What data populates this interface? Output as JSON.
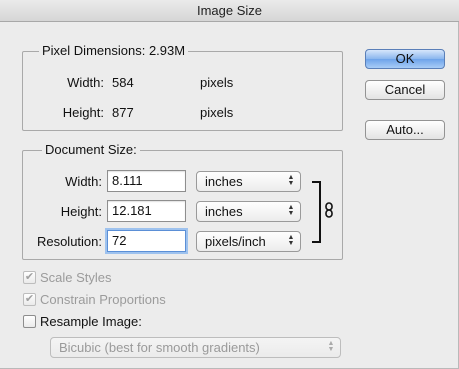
{
  "window": {
    "title": "Image Size"
  },
  "pixel_dimensions": {
    "legend": "Pixel Dimensions:",
    "size": "2.93M",
    "width_label": "Width:",
    "width_value": "584",
    "width_unit": "pixels",
    "height_label": "Height:",
    "height_value": "877",
    "height_unit": "pixels"
  },
  "document_size": {
    "legend": "Document Size:",
    "width_label": "Width:",
    "width_value": "8.111",
    "width_unit": "inches",
    "height_label": "Height:",
    "height_value": "12.181",
    "height_unit": "inches",
    "resolution_label": "Resolution:",
    "resolution_value": "72",
    "resolution_unit": "pixels/inch"
  },
  "options": {
    "scale_styles": "Scale Styles",
    "constrain_proportions": "Constrain Proportions",
    "resample_image": "Resample Image:",
    "resample_method": "Bicubic (best for smooth gradients)"
  },
  "buttons": {
    "ok": "OK",
    "cancel": "Cancel",
    "auto": "Auto..."
  },
  "glyphs": {
    "check": "✔",
    "arrows_up": "▲",
    "arrows_down": "▼",
    "link": "🔗"
  }
}
